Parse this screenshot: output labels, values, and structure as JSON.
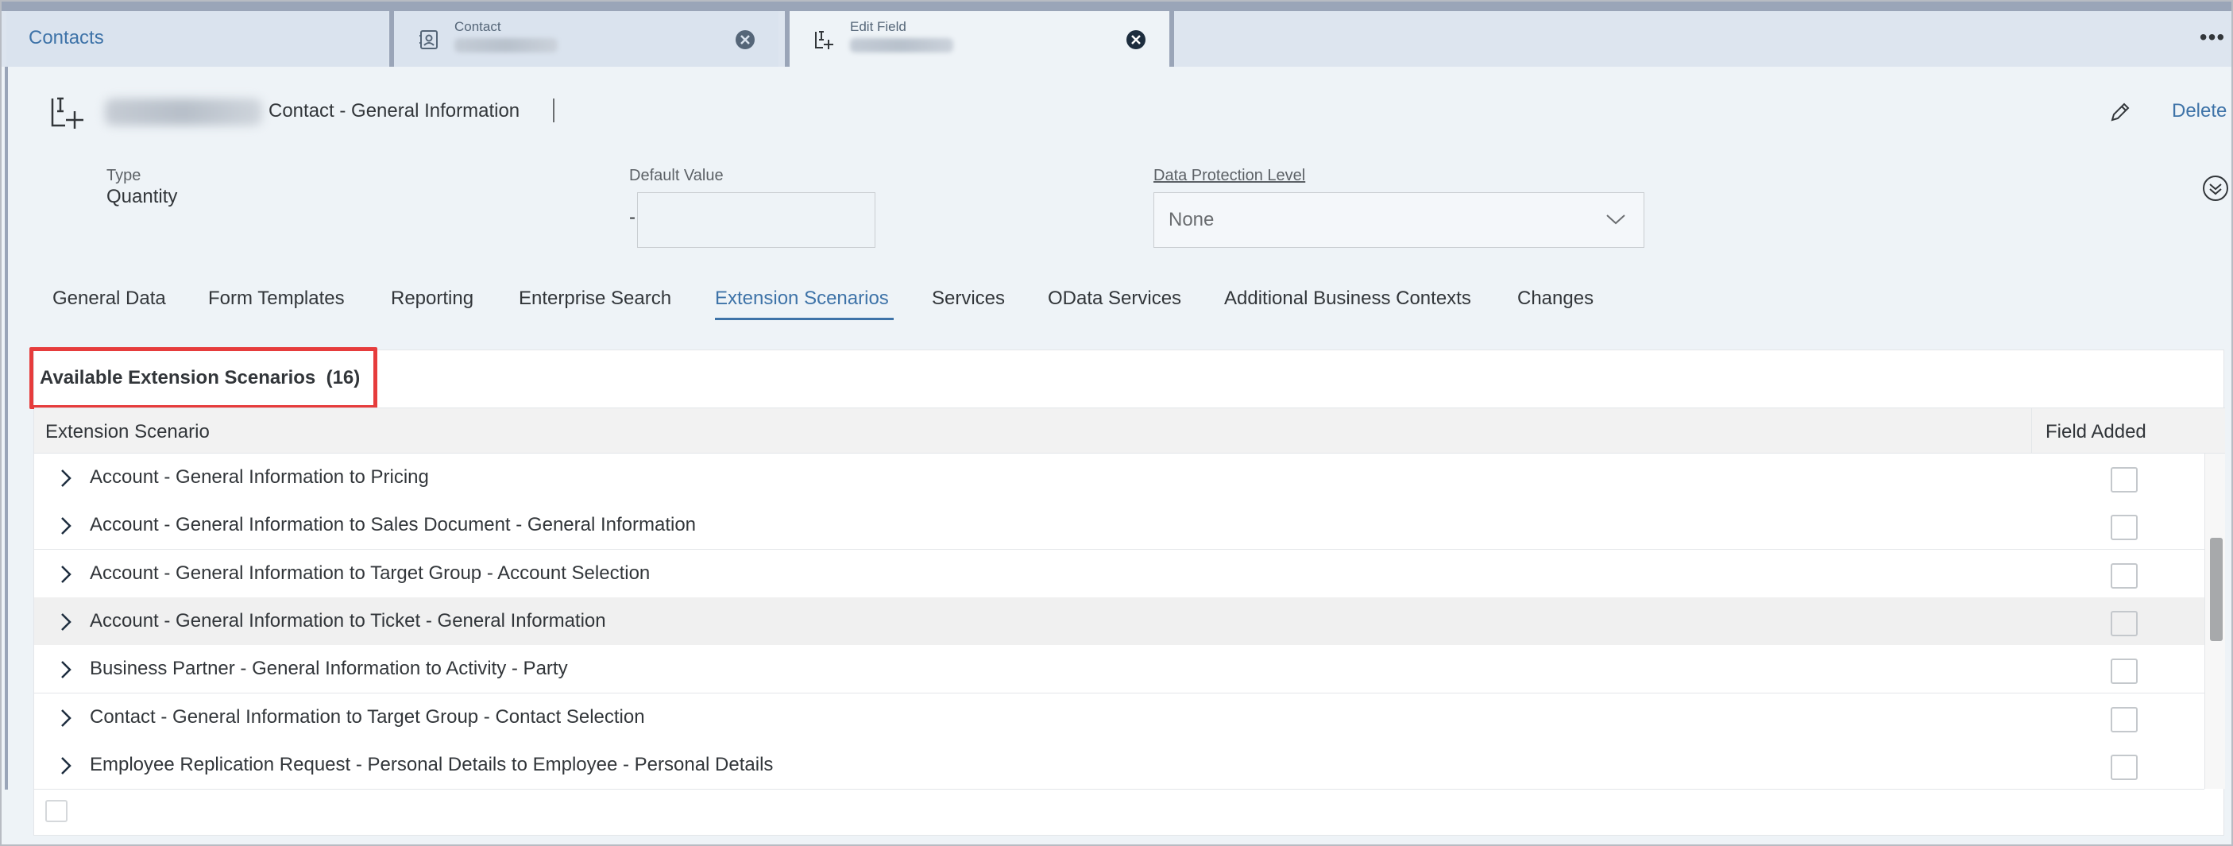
{
  "tabs": {
    "home_label": "Contacts",
    "contact_title": "Contact",
    "edit_title": "Edit Field",
    "overflow": "•••"
  },
  "header": {
    "title": "Contact - General Information",
    "delete_label": "Delete"
  },
  "fields": {
    "type_label": "Type",
    "type_value": "Quantity",
    "default_label": "Default Value",
    "default_dash": "-",
    "dp_label": "Data Protection Level",
    "dp_value": "None"
  },
  "nav": {
    "active": "Extension Scenarios",
    "items": [
      "General Data",
      "Form Templates",
      "Reporting",
      "Enterprise Search",
      "Extension Scenarios",
      "Services",
      "OData Services",
      "Additional Business Contexts",
      "Changes"
    ]
  },
  "panel": {
    "title": "Available Extension Scenarios",
    "count": "(16)",
    "col_scenario": "Extension Scenario",
    "col_added": "Field Added"
  },
  "rows": [
    {
      "text": "Account - General Information to Pricing",
      "checked": false
    },
    {
      "text": "Account - General Information to Sales Document - General Information",
      "checked": false
    },
    {
      "text": "Account - General Information to Target Group - Account Selection",
      "checked": false
    },
    {
      "text": "Account - General Information to Ticket - General Information",
      "checked": false,
      "hover": true
    },
    {
      "text": "Business Partner - General Information to Activity - Party",
      "checked": false
    },
    {
      "text": "Contact - General Information to Target Group - Contact Selection",
      "checked": false
    },
    {
      "text": "Employee Replication Request - Personal Details to Employee - Personal Details",
      "checked": false
    }
  ],
  "colors": {
    "accent": "#3e73a8",
    "highlight_box": "#e63c3c"
  }
}
